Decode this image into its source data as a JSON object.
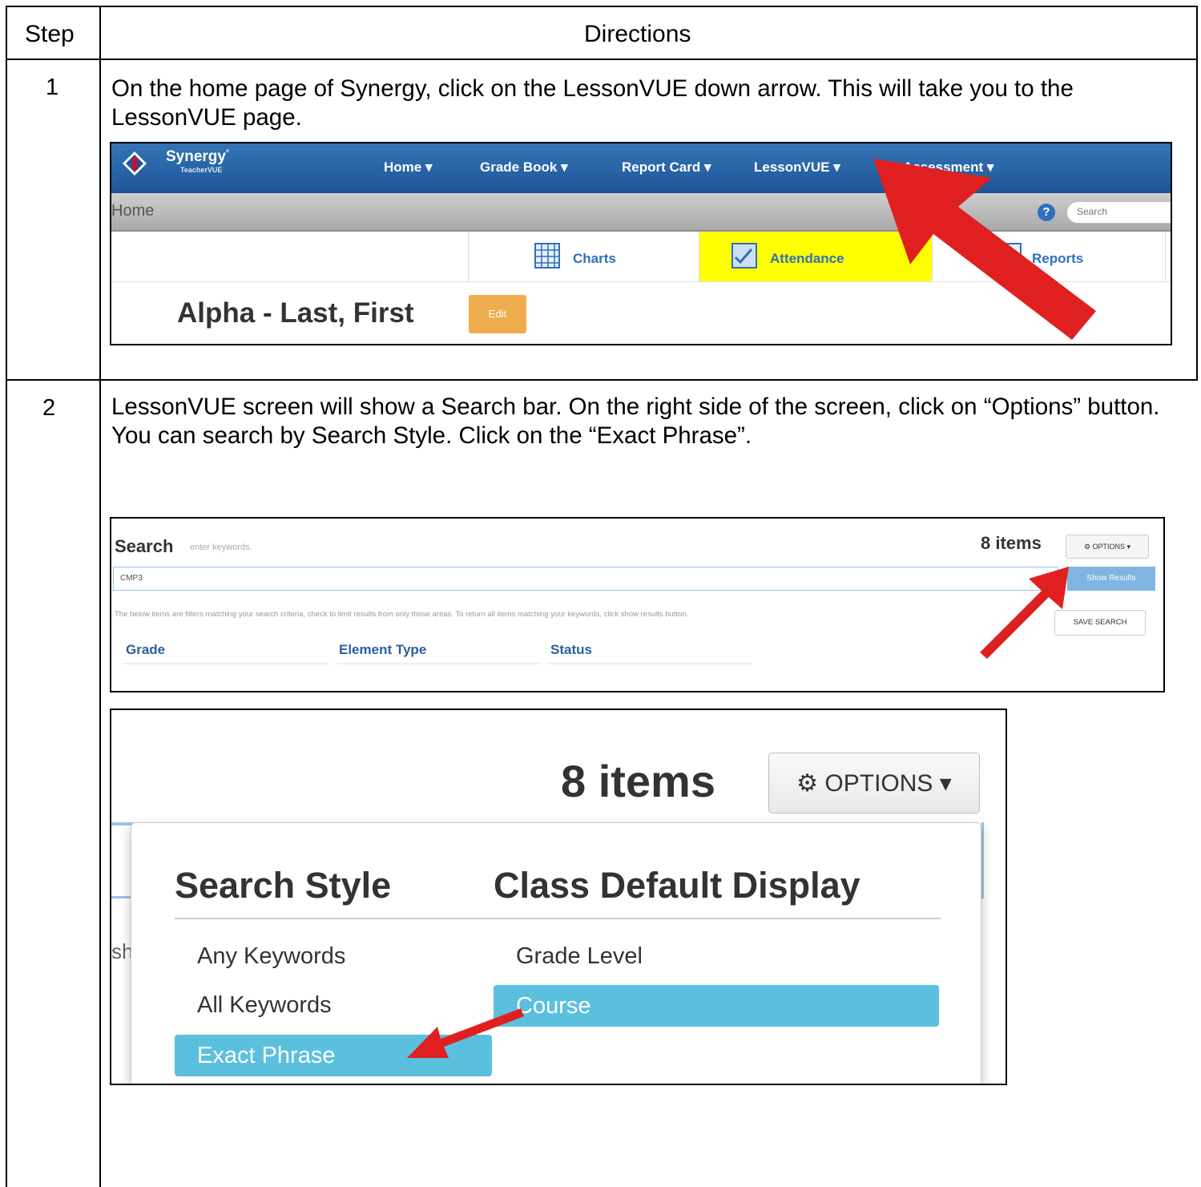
{
  "table": {
    "col_step": "Step",
    "col_directions": "Directions",
    "rows": [
      {
        "step": "1",
        "text": "On the home page of Synergy, click on the LessonVUE down arrow.  This will take you to the LessonVUE page."
      },
      {
        "step": "2",
        "text": "LessonVUE screen will show a Search bar.  On the right side of the screen, click on “Options” button.  You can search by Search Style.  Click on the “Exact Phrase”."
      }
    ]
  },
  "shot1": {
    "logo_text": "Synergy",
    "logo_mark": "°",
    "logo_sub": "TeacherVUE",
    "nav": [
      "Home ▾",
      "Grade Book ▾",
      "Report Card ▾",
      "LessonVUE ▾",
      "Assessment ▾"
    ],
    "breadcrumb": "Home",
    "help": "?",
    "search_placeholder": "Search",
    "tiles": [
      "Charts",
      "Attendance",
      "Reports"
    ],
    "student_name": "Alpha - Last, First",
    "edit_label": "Edit",
    "highlight_color": "#ffff00",
    "nav_color": "#1e5698"
  },
  "shot2": {
    "title": "Search",
    "hint": "enter keywords.",
    "count": "8 items",
    "options_label": "⚙ OPTIONS ▾",
    "input_value": "CMP3",
    "show_results": "Show Results",
    "note": "The below items are filters matching your search criteria, check to limit results from only those areas. To return all items matching your keywords, click show results button.",
    "save_search": "SAVE SEARCH",
    "columns": [
      "Grade",
      "Element Type",
      "Status"
    ]
  },
  "shot3": {
    "count": "8 items",
    "options_label": "⚙ OPTIONS ▾",
    "behind_text": "sh",
    "search_style": {
      "heading": "Search Style",
      "items": [
        "Any Keywords",
        "All Keywords",
        "Exact Phrase"
      ],
      "selected": "Exact Phrase"
    },
    "class_default": {
      "heading": "Class Default Display",
      "items": [
        "Grade Level",
        "Course"
      ],
      "selected": "Course"
    },
    "selected_color": "#5bc0de"
  },
  "arrow_color": "#e02020"
}
